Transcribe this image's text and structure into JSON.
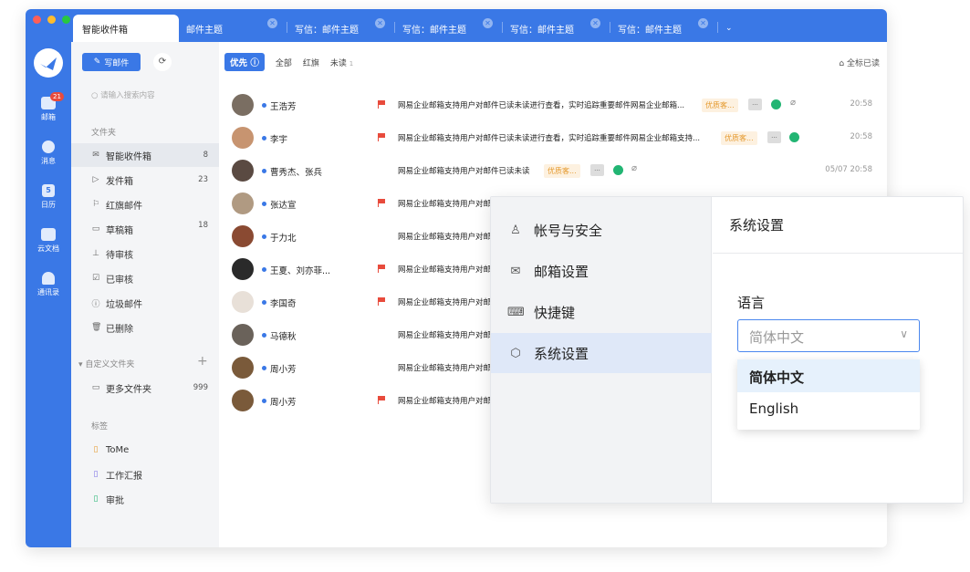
{
  "tabs": {
    "active": "智能收件箱",
    "t1": "邮件主题",
    "t2": "写信：邮件主题",
    "t3": "写信：邮件主题",
    "t4": "写信：邮件主题",
    "t5": "写信：邮件主题"
  },
  "rail": {
    "mail": "邮箱",
    "mail_badge": "21",
    "msg": "消息",
    "cal": "日历",
    "doc": "云文档",
    "contacts": "通讯录",
    "cal_day": "5"
  },
  "folders": {
    "compose": "写邮件",
    "search_placeholder": "请输入搜索内容",
    "section": "文件夹",
    "items": [
      {
        "label": "智能收件箱",
        "count": "8"
      },
      {
        "label": "发件箱",
        "count": "23"
      },
      {
        "label": "红旗邮件",
        "count": ""
      },
      {
        "label": "草稿箱",
        "count": "18"
      },
      {
        "label": "待审核",
        "count": ""
      },
      {
        "label": "已审核",
        "count": ""
      },
      {
        "label": "垃圾邮件",
        "count": ""
      },
      {
        "label": "已删除",
        "count": ""
      }
    ],
    "custom_section": "自定义文件夹",
    "more_folders": "更多文件夹",
    "more_count": "999",
    "tags_section": "标签",
    "tags": [
      "ToMe",
      "工作汇报",
      "审批"
    ]
  },
  "filter": {
    "priority": "优先",
    "all": "全部",
    "flag": "红旗",
    "unread": "未读",
    "unread_count": "1",
    "mark_all": "全标已读"
  },
  "mails": [
    {
      "sender": "王浩芳",
      "subject": "网易企业邮箱支持用户对邮件已读未读进行查看，实时追踪重要邮件网易企业邮箱...",
      "tag": "优质客...",
      "time": "20:58"
    },
    {
      "sender": "李宇",
      "subject": "网易企业邮箱支持用户对邮件已读未读进行查看，实时追踪重要邮件网易企业邮箱支持...",
      "tag": "优质客...",
      "time": "20:58"
    },
    {
      "sender": "曹秀杰、张兵",
      "subject": "网易企业邮箱支持用户对邮件已读未读",
      "tag": "优质客...",
      "time": "05/07 20:58"
    },
    {
      "sender": "张达宣",
      "subject": "网易企业邮箱支持用户对邮",
      "tag": "",
      "time": ""
    },
    {
      "sender": "于力北",
      "subject": "网易企业邮箱支持用户对邮",
      "tag": "",
      "time": ""
    },
    {
      "sender": "王夏、刘亦菲...",
      "subject": "网易企业邮箱支持用户对邮",
      "tag": "",
      "time": ""
    },
    {
      "sender": "李国奇",
      "subject": "网易企业邮箱支持用户对邮",
      "tag": "",
      "time": ""
    },
    {
      "sender": "马德秋",
      "subject": "网易企业邮箱支持用户对邮",
      "tag": "",
      "time": ""
    },
    {
      "sender": "周小芳",
      "subject": "网易企业邮箱支持用户对邮",
      "tag": "",
      "time": ""
    },
    {
      "sender": "周小芳",
      "subject": "网易企业邮箱支持用户对邮",
      "tag": "",
      "time": ""
    }
  ],
  "settings": {
    "nav": [
      "帐号与安全",
      "邮箱设置",
      "快捷键",
      "系统设置"
    ],
    "title": "系统设置",
    "lang_label": "语言",
    "lang_value": "简体中文",
    "options": [
      "简体中文",
      "English"
    ]
  },
  "colors": {
    "accent": "#3a78e6",
    "flag": "#e84b3c",
    "tag": "#e59a2f"
  }
}
